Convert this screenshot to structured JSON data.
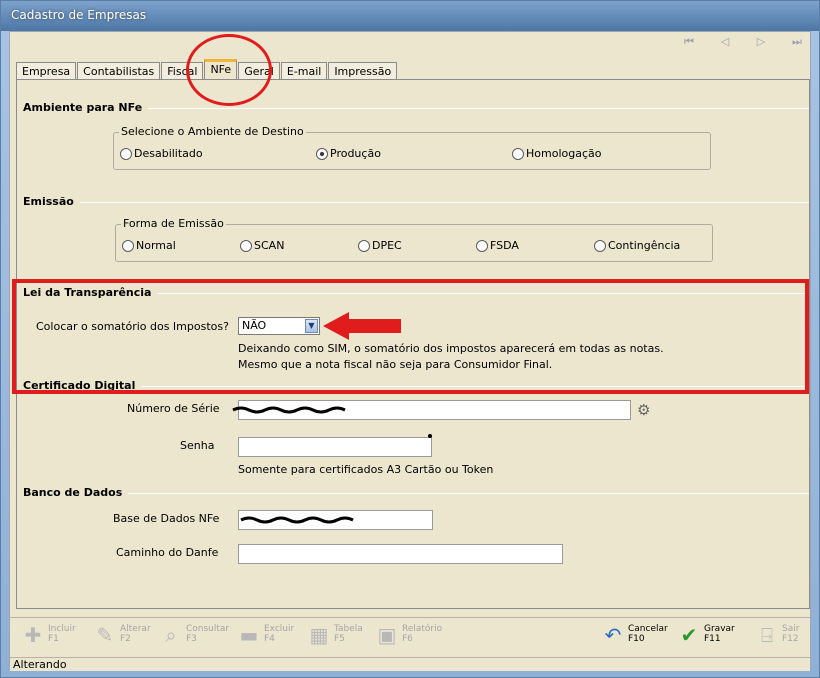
{
  "window": {
    "title": "Cadastro de Empresas"
  },
  "nav": {
    "first": "⏮",
    "prev": "◁",
    "next": "▷",
    "last": "⏭"
  },
  "tabs": [
    "Empresa",
    "Contabilistas",
    "Fiscal",
    "NFe",
    "Geral",
    "E-mail",
    "Impressão"
  ],
  "ambiente": {
    "section_title": "Ambiente para NFe",
    "group_label": "Selecione o Ambiente de Destino",
    "options": [
      "Desabilitado",
      "Produção",
      "Homologação"
    ],
    "selected": "Produção"
  },
  "emissao": {
    "section_title": "Emissão",
    "group_label": "Forma de Emissão",
    "options": [
      "Normal",
      "SCAN",
      "DPEC",
      "FSDA",
      "Contingência"
    ],
    "selected": null
  },
  "transparencia": {
    "section_title": "Lei da Transparência",
    "question_label": "Colocar o somatório dos Impostos?",
    "select_value": "NÃO",
    "note_line1": "Deixando como SIM, o somatório dos impostos aparecerá em todas as notas.",
    "note_line2": "Mesmo que a nota fiscal não seja para Consumidor Final."
  },
  "certificado": {
    "section_title": "Certificado Digital",
    "serial_label": "Número de Série",
    "serial_value": "",
    "password_label": "Senha",
    "password_value": "",
    "note": "Somente para certificados A3 Cartão ou Token"
  },
  "banco": {
    "section_title": "Banco de Dados",
    "base_label": "Base de Dados NFe",
    "base_value": "",
    "danfe_label": "Caminho do Danfe",
    "danfe_value": ""
  },
  "toolbar": [
    {
      "label": "Incluir",
      "key": "F1",
      "icon": "plus-icon",
      "enabled": false
    },
    {
      "label": "Alterar",
      "key": "F2",
      "icon": "pencil-icon",
      "enabled": false
    },
    {
      "label": "Consultar",
      "key": "F3",
      "icon": "magnifier-icon",
      "enabled": false
    },
    {
      "label": "Excluir",
      "key": "F4",
      "icon": "minus-icon",
      "enabled": false
    },
    {
      "label": "Tabela",
      "key": "F5",
      "icon": "table-icon",
      "enabled": false
    },
    {
      "label": "Relatório",
      "key": "F6",
      "icon": "clipboard-icon",
      "enabled": false
    },
    {
      "label": "Cancelar",
      "key": "F10",
      "icon": "undo-icon",
      "enabled": true
    },
    {
      "label": "Gravar",
      "key": "F11",
      "icon": "checkmark-icon",
      "enabled": true
    },
    {
      "label": "Sair",
      "key": "F12",
      "icon": "exit-door-icon",
      "enabled": false
    }
  ],
  "status": {
    "text": "Alterando"
  },
  "colors": {
    "annotation": "#e01c1c",
    "active_tab_accent": "#f2b53b",
    "panel_bg": "#ece6cf"
  }
}
